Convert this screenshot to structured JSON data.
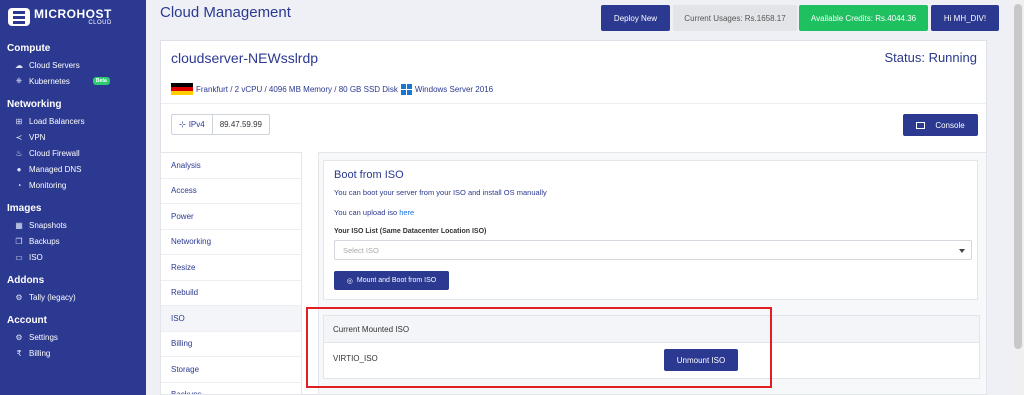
{
  "brand": {
    "name": "MICROHOST",
    "sub": "CLOUD"
  },
  "sidebar": {
    "sections": [
      {
        "title": "Compute",
        "items": [
          {
            "label": "Cloud Servers",
            "icon": "cloud-icon"
          },
          {
            "label": "Kubernetes",
            "icon": "kubernetes-icon",
            "badge": "Beta"
          }
        ]
      },
      {
        "title": "Networking",
        "items": [
          {
            "label": "Load Balancers",
            "icon": "sitemap-icon"
          },
          {
            "label": "VPN",
            "icon": "share-icon"
          },
          {
            "label": "Cloud Firewall",
            "icon": "fire-icon"
          },
          {
            "label": "Managed DNS",
            "icon": "globe-icon"
          },
          {
            "label": "Monitoring",
            "icon": "gauge-icon"
          }
        ]
      },
      {
        "title": "Images",
        "items": [
          {
            "label": "Snapshots",
            "icon": "images-icon"
          },
          {
            "label": "Backups",
            "icon": "copy-icon"
          },
          {
            "label": "ISO",
            "icon": "disc-drive-icon"
          }
        ]
      },
      {
        "title": "Addons",
        "items": [
          {
            "label": "Tally (legacy)",
            "icon": "gears-icon"
          }
        ]
      },
      {
        "title": "Account",
        "items": [
          {
            "label": "Settings",
            "icon": "gears-icon"
          },
          {
            "label": "Billing",
            "icon": "rupee-icon"
          }
        ]
      }
    ]
  },
  "header": {
    "title": "Cloud Management",
    "deploy_label": "Deploy New",
    "usage_label": "Current Usages: Rs.1658.17",
    "credits_label": "Available Credits: Rs.4044.36",
    "user_label": "Hi MH_DIV!"
  },
  "server": {
    "name": "cloudserver-NEWsslrdp",
    "status": "Status: Running",
    "specs": "Frankfurt / 2 vCPU / 4096 MB Memory / 80 GB SSD Disk",
    "os": "Windows Server 2016",
    "ip_type": "IPv4",
    "ip": "89.47.59.99",
    "console_label": "Console"
  },
  "menu": {
    "items": [
      "Analysis",
      "Access",
      "Power",
      "Networking",
      "Resize",
      "Rebuild",
      "ISO",
      "Billing",
      "Storage",
      "Backups"
    ],
    "active": "ISO"
  },
  "boot": {
    "title": "Boot from ISO",
    "description": "You can boot your server from your ISO and install OS manually",
    "upload_prefix": "You can upload iso",
    "upload_link": "here",
    "list_label": "Your ISO List (Same Datacenter Location ISO)",
    "select_placeholder": "Select ISO",
    "mount_label": "Mount and Boot from ISO"
  },
  "current": {
    "title": "Current Mounted ISO",
    "iso_name": "VIRTIO_ISO",
    "unmount_label": "Unmount ISO"
  },
  "colors": {
    "brand": "#2b3990",
    "success": "#1fc05f",
    "highlight": "#e02020"
  }
}
